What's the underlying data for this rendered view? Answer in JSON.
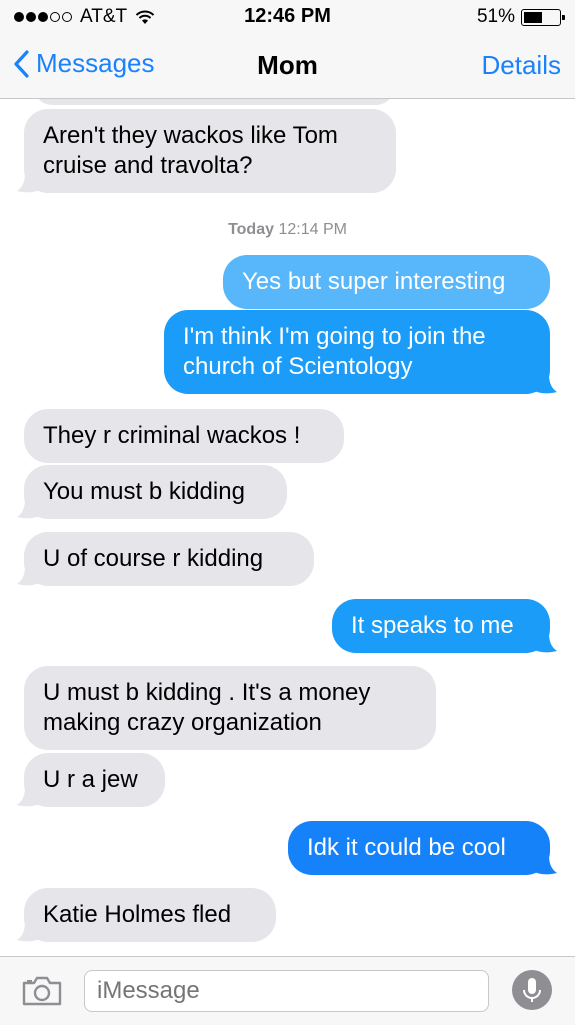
{
  "status": {
    "carrier": "AT&T",
    "time": "12:46 PM",
    "battery": "51%",
    "battery_level": 0.51,
    "signal_bars": 3
  },
  "nav": {
    "back_label": "Messages",
    "title": "Mom",
    "details_label": "Details"
  },
  "timestamp": {
    "day": "Today",
    "time": "12:14 PM"
  },
  "messages": [
    {
      "from": "them",
      "text": "Aren't they wackos like Tom cruise and travolta?"
    },
    {
      "from": "me",
      "text": "Yes but super interesting"
    },
    {
      "from": "me",
      "text": "I'm think I'm going to join the church of Scientology"
    },
    {
      "from": "them",
      "text": "They r criminal wackos !"
    },
    {
      "from": "them",
      "text": "You must b kidding"
    },
    {
      "from": "them",
      "text": "U of course r kidding"
    },
    {
      "from": "me",
      "text": "It speaks to me"
    },
    {
      "from": "them",
      "text": "U must b kidding . It's a money making crazy organization"
    },
    {
      "from": "them",
      "text": "U r a jew"
    },
    {
      "from": "me",
      "text": "Idk it could be cool"
    },
    {
      "from": "them",
      "text": "Katie Holmes fled"
    }
  ],
  "input": {
    "placeholder": "iMessage"
  },
  "colors": {
    "accent": "#1a82fb",
    "sent_bubble": "#1a9cf8",
    "received_bubble": "#e5e5ea"
  },
  "icons": {
    "back": "chevron-left-icon",
    "camera": "camera-icon",
    "mic": "microphone-icon",
    "wifi": "wifi-icon",
    "battery": "battery-icon"
  }
}
